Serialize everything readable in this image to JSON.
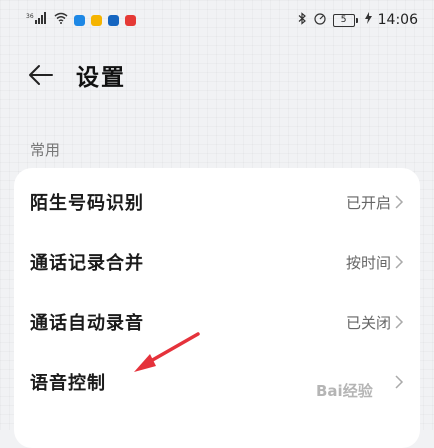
{
  "status_bar": {
    "signal_text": "36",
    "time": "14:06",
    "battery_level": "5"
  },
  "header": {
    "title": "设置"
  },
  "section": {
    "label": "常用"
  },
  "rows": [
    {
      "label": "陌生号码识别",
      "value": "已开启"
    },
    {
      "label": "通话记录合并",
      "value": "按时间"
    },
    {
      "label": "通话自动录音",
      "value": "已关闭"
    },
    {
      "label": "语音控制",
      "value": ""
    }
  ],
  "watermark": "Bai经验",
  "colors": {
    "background": "#f1f2f4",
    "card": "#ffffff",
    "arrow": "#e5323b"
  },
  "icons": {
    "back": "arrow-left-icon",
    "chevron": "chevron-right-icon"
  }
}
